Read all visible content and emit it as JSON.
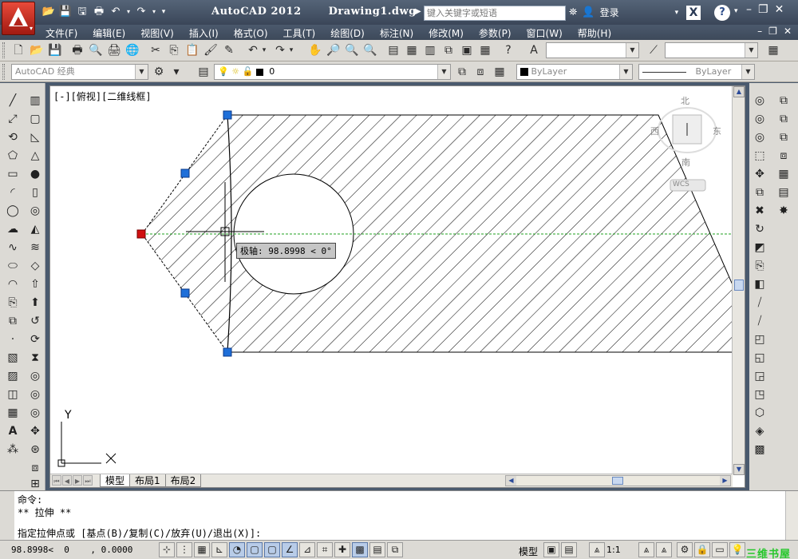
{
  "window": {
    "app_name": "AutoCAD 2012",
    "document": "Drawing1.dwg",
    "search_placeholder": "键入关键字或短语",
    "login_label": "登录"
  },
  "menu": [
    "文件(F)",
    "编辑(E)",
    "视图(V)",
    "插入(I)",
    "格式(O)",
    "工具(T)",
    "绘图(D)",
    "标注(N)",
    "修改(M)",
    "参数(P)",
    "窗口(W)",
    "帮助(H)"
  ],
  "toolbar": {
    "workspace": "AutoCAD 经典",
    "layer_value": "0",
    "color_value": "ByLayer",
    "linetype_value": "ByLayer"
  },
  "viewport": {
    "label": "[-][俯视][二维线框]",
    "tooltip": "极轴: 98.8998 < 0°",
    "axis_y": "Y",
    "viewcube": {
      "north": "北",
      "south": "南",
      "east": "东",
      "west": "西",
      "wcs": "WCS"
    }
  },
  "tabs": [
    "模型",
    "布局1",
    "布局2"
  ],
  "command": {
    "line1": "命令:",
    "line2": "** 拉伸 **",
    "prompt": "指定拉伸点或 [基点(B)/复制(C)/放弃(U)/退出(X)]:"
  },
  "status": {
    "coordinates": "98.8998<  0    , 0.0000",
    "model": "模型",
    "scale": "1:1"
  },
  "watermark": "三维书屋",
  "colors": {
    "accent": "#1e6fd9",
    "grip_hot": "#d01010",
    "polar_line": "#22a022",
    "titlebar": "#3a4658"
  }
}
